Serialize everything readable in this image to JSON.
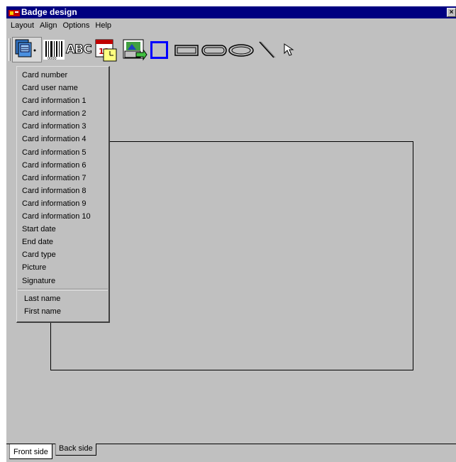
{
  "window": {
    "title": "Badge design",
    "close_glyph": "×"
  },
  "menu": [
    "Layout",
    "Align",
    "Options",
    "Help"
  ],
  "toolbar": {
    "tools": [
      "field-list-icon",
      "barcode-icon",
      "text-abc-icon",
      "date-calendar-icon",
      "picture-import-icon",
      "square-icon",
      "rectangle-icon",
      "rounded-rectangle-icon",
      "ellipse-icon",
      "line-icon",
      "pointer-icon"
    ],
    "abc_text": "ABC",
    "date_digits": "12",
    "colors": {
      "square_border": "#0000ff"
    }
  },
  "dropdown": {
    "items": [
      "Card number",
      "Card user name",
      "Card information 1",
      "Card information 2",
      "Card information 3",
      "Card information 4",
      "Card information 5",
      "Card information 6",
      "Card information 7",
      "Card information 8",
      "Card information 9",
      "Card information 10",
      "Start date",
      "End date",
      "Card type",
      "Picture",
      "Signature"
    ],
    "extra_items": [
      "Last name",
      "First name"
    ]
  },
  "tabs": {
    "front": "Front side",
    "back": "Back side",
    "active": "Front side"
  }
}
